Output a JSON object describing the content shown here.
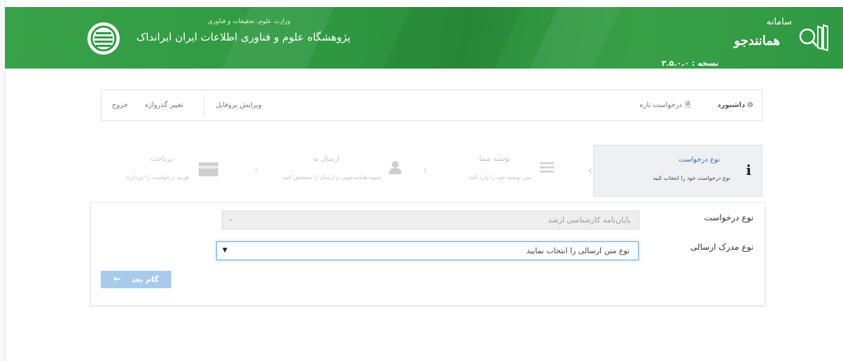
{
  "header": {
    "system_label": "سامانه",
    "system_name": "همانندجو",
    "version": "نسخه : ۲.۵.۰.۰",
    "institute_subtitle": "وزارت علوم، تحقیقات و فناوری",
    "institute_name": "پژوهشگاه علوم و فناوری اطلاعات ایران  ایرانداک"
  },
  "nav": {
    "dashboard": "داشبورد",
    "new_request": "درخواست تازه",
    "profile_edit": "ویرایش پروفایل",
    "change_password": "تغییر گذرواژه",
    "logout": "خروج"
  },
  "wizard": {
    "steps": [
      {
        "title": "نوع درخواست",
        "desc": "نوع درخواست خود را انتخاب کنید",
        "state": "active",
        "icon": "info-icon"
      },
      {
        "title": "نوشته شما",
        "desc": "متن نوشته خود را وارد کنید",
        "state": "inactive",
        "icon": "list-icon"
      },
      {
        "title": "ارسال به",
        "desc": "شیوه همانندجویی و ارسال را مشخص کنید",
        "state": "inactive",
        "icon": "user-icon"
      },
      {
        "title": "پرداخت",
        "desc": "هزینه درخواست را بپردازید",
        "state": "inactive",
        "icon": "credit-card-icon"
      }
    ]
  },
  "form": {
    "request_type_label": "نوع درخواست",
    "request_type_value": "پایان‌نامه کارشناسی ارشد",
    "doc_type_label": "نوع مدرک ارسالی",
    "doc_type_placeholder": "نوع متن ارسالی را انتخاب نمایید",
    "next_button": "گام بعد"
  },
  "colors": {
    "header_green": "#2f9a42",
    "active_border": "#66afe9",
    "button_disabled": "#a9cbeb",
    "link_blue": "#3a6ea5"
  }
}
